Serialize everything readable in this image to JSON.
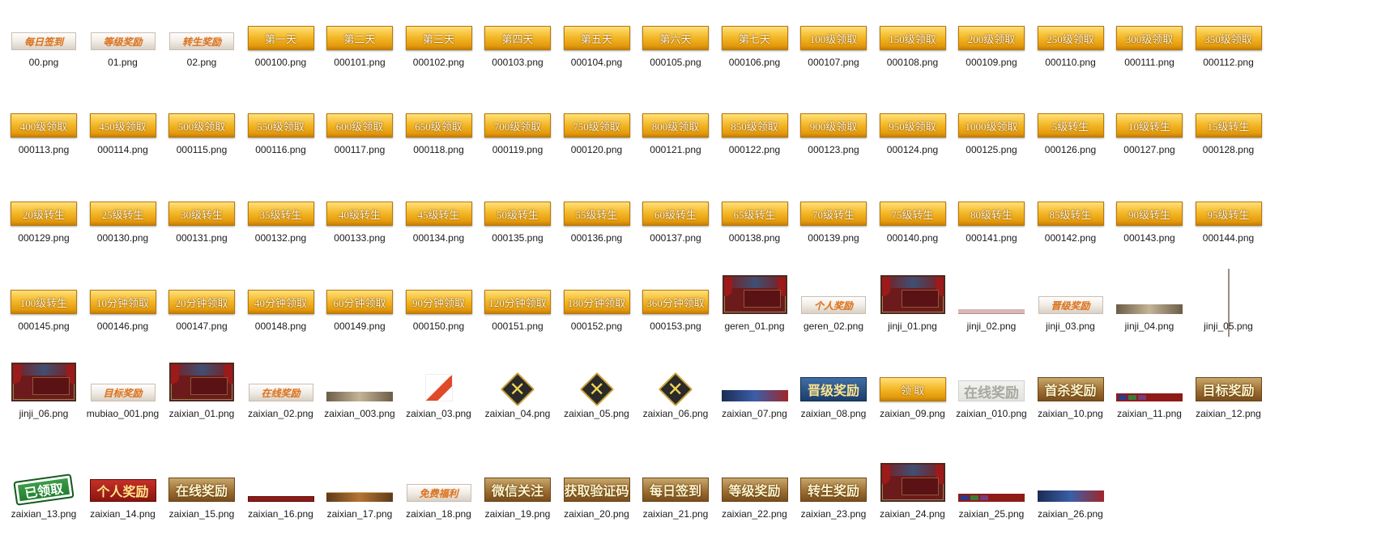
{
  "folder_view": {
    "items": [
      {
        "file": "00.png",
        "style": "scroll",
        "label": "每日签到"
      },
      {
        "file": "01.png",
        "style": "scroll",
        "label": "等级奖励"
      },
      {
        "file": "02.png",
        "style": "scroll",
        "label": "转生奖励"
      },
      {
        "file": "000100.png",
        "style": "gold",
        "label": "第一天"
      },
      {
        "file": "000101.png",
        "style": "gold",
        "label": "第二天"
      },
      {
        "file": "000102.png",
        "style": "gold",
        "label": "第三天"
      },
      {
        "file": "000103.png",
        "style": "gold",
        "label": "第四天"
      },
      {
        "file": "000104.png",
        "style": "gold",
        "label": "第五天"
      },
      {
        "file": "000105.png",
        "style": "gold",
        "label": "第六天"
      },
      {
        "file": "000106.png",
        "style": "gold",
        "label": "第七天"
      },
      {
        "file": "000107.png",
        "style": "gold",
        "label": "100级领取"
      },
      {
        "file": "000108.png",
        "style": "gold",
        "label": "150级领取"
      },
      {
        "file": "000109.png",
        "style": "gold",
        "label": "200级领取"
      },
      {
        "file": "000110.png",
        "style": "gold",
        "label": "250级领取"
      },
      {
        "file": "000111.png",
        "style": "gold",
        "label": "300级领取"
      },
      {
        "file": "000112.png",
        "style": "gold",
        "label": "350级领取"
      },
      {
        "file": "000113.png",
        "style": "gold",
        "label": "400级领取"
      },
      {
        "file": "000114.png",
        "style": "gold",
        "label": "450级领取"
      },
      {
        "file": "000115.png",
        "style": "gold",
        "label": "500级领取"
      },
      {
        "file": "000116.png",
        "style": "gold",
        "label": "550级领取"
      },
      {
        "file": "000117.png",
        "style": "gold",
        "label": "600级领取"
      },
      {
        "file": "000118.png",
        "style": "gold",
        "label": "650级领取"
      },
      {
        "file": "000119.png",
        "style": "gold",
        "label": "700级领取"
      },
      {
        "file": "000120.png",
        "style": "gold",
        "label": "750级领取"
      },
      {
        "file": "000121.png",
        "style": "gold",
        "label": "800级领取"
      },
      {
        "file": "000122.png",
        "style": "gold",
        "label": "850级领取"
      },
      {
        "file": "000123.png",
        "style": "gold",
        "label": "900级领取"
      },
      {
        "file": "000124.png",
        "style": "gold",
        "label": "950级领取"
      },
      {
        "file": "000125.png",
        "style": "gold",
        "label": "1000级领取"
      },
      {
        "file": "000126.png",
        "style": "gold",
        "label": "5级转生"
      },
      {
        "file": "000127.png",
        "style": "gold",
        "label": "10级转生"
      },
      {
        "file": "000128.png",
        "style": "gold",
        "label": "15级转生"
      },
      {
        "file": "000129.png",
        "style": "gold",
        "label": "20级转生"
      },
      {
        "file": "000130.png",
        "style": "gold",
        "label": "25级转生"
      },
      {
        "file": "000131.png",
        "style": "gold",
        "label": "30级转生"
      },
      {
        "file": "000132.png",
        "style": "gold",
        "label": "35级转生"
      },
      {
        "file": "000133.png",
        "style": "gold",
        "label": "40级转生"
      },
      {
        "file": "000134.png",
        "style": "gold",
        "label": "45级转生"
      },
      {
        "file": "000135.png",
        "style": "gold",
        "label": "50级转生"
      },
      {
        "file": "000136.png",
        "style": "gold",
        "label": "55级转生"
      },
      {
        "file": "000137.png",
        "style": "gold",
        "label": "60级转生"
      },
      {
        "file": "000138.png",
        "style": "gold",
        "label": "65级转生"
      },
      {
        "file": "000139.png",
        "style": "gold",
        "label": "70级转生"
      },
      {
        "file": "000140.png",
        "style": "gold",
        "label": "75级转生"
      },
      {
        "file": "000141.png",
        "style": "gold",
        "label": "80级转生"
      },
      {
        "file": "000142.png",
        "style": "gold",
        "label": "85级转生"
      },
      {
        "file": "000143.png",
        "style": "gold",
        "label": "90级转生"
      },
      {
        "file": "000144.png",
        "style": "gold",
        "label": "95级转生"
      },
      {
        "file": "000145.png",
        "style": "gold",
        "label": "100级转生"
      },
      {
        "file": "000146.png",
        "style": "gold",
        "label": "10分钟领取"
      },
      {
        "file": "000147.png",
        "style": "gold",
        "label": "20分钟领取"
      },
      {
        "file": "000148.png",
        "style": "gold",
        "label": "40分钟领取"
      },
      {
        "file": "000149.png",
        "style": "gold",
        "label": "60分钟领取"
      },
      {
        "file": "000150.png",
        "style": "gold",
        "label": "90分钟领取"
      },
      {
        "file": "000151.png",
        "style": "gold",
        "label": "120分钟领取"
      },
      {
        "file": "000152.png",
        "style": "gold",
        "label": "180分钟领取"
      },
      {
        "file": "000153.png",
        "style": "gold",
        "label": "360分钟领取"
      },
      {
        "file": "geren_01.png",
        "style": "panel",
        "label": ""
      },
      {
        "file": "geren_02.png",
        "style": "scroll",
        "label": "个人奖励"
      },
      {
        "file": "jinji_01.png",
        "style": "panel",
        "label": ""
      },
      {
        "file": "jinji_02.png",
        "style": "hline",
        "label": ""
      },
      {
        "file": "jinji_03.png",
        "style": "scroll",
        "label": "晋级奖励"
      },
      {
        "file": "jinji_04.png",
        "style": "bar-text",
        "label": ""
      },
      {
        "file": "jinji_05.png",
        "style": "vline",
        "label": ""
      },
      {
        "file": "jinji_06.png",
        "style": "panel",
        "label": ""
      },
      {
        "file": "mubiao_001.png",
        "style": "scroll",
        "label": "目标奖励"
      },
      {
        "file": "zaixian_01.png",
        "style": "panel",
        "label": ""
      },
      {
        "file": "zaixian_02.png",
        "style": "scroll",
        "label": "在线奖励"
      },
      {
        "file": "zaixian_003.png",
        "style": "bar-text",
        "label": ""
      },
      {
        "file": "zaixian_03.png",
        "style": "corner",
        "label": ""
      },
      {
        "file": "zaixian_04.png",
        "style": "xicon",
        "label": "✕"
      },
      {
        "file": "zaixian_05.png",
        "style": "xicon",
        "label": "✕"
      },
      {
        "file": "zaixian_06.png",
        "style": "xicon",
        "label": "✕"
      },
      {
        "file": "zaixian_07.png",
        "style": "bar-blue",
        "label": ""
      },
      {
        "file": "zaixian_08.png",
        "style": "blue",
        "label": "晋级奖励"
      },
      {
        "file": "zaixian_09.png",
        "style": "gold",
        "label": "领 取"
      },
      {
        "file": "zaixian_010.png",
        "style": "grey",
        "label": "在线奖励"
      },
      {
        "file": "zaixian_10.png",
        "style": "brown",
        "label": "首杀奖励"
      },
      {
        "file": "zaixian_11.png",
        "style": "swatches",
        "label": ""
      },
      {
        "file": "zaixian_12.png",
        "style": "brown",
        "label": "目标奖励"
      },
      {
        "file": "zaixian_13.png",
        "style": "green",
        "label": "已领取"
      },
      {
        "file": "zaixian_14.png",
        "style": "redbtn",
        "label": "个人奖励"
      },
      {
        "file": "zaixian_15.png",
        "style": "brown",
        "label": "在线奖励"
      },
      {
        "file": "zaixian_16.png",
        "style": "bar-red",
        "label": ""
      },
      {
        "file": "zaixian_17.png",
        "style": "bar-dark",
        "label": ""
      },
      {
        "file": "zaixian_18.png",
        "style": "scroll",
        "label": "免费福利"
      },
      {
        "file": "zaixian_19.png",
        "style": "brown",
        "label": "微信关注"
      },
      {
        "file": "zaixian_20.png",
        "style": "brown",
        "label": "获取验证码"
      },
      {
        "file": "zaixian_21.png",
        "style": "brown",
        "label": "每日签到"
      },
      {
        "file": "zaixian_22.png",
        "style": "brown",
        "label": "等级奖励"
      },
      {
        "file": "zaixian_23.png",
        "style": "brown",
        "label": "转生奖励"
      },
      {
        "file": "zaixian_24.png",
        "style": "panel",
        "label": ""
      },
      {
        "file": "zaixian_25.png",
        "style": "swatches",
        "label": ""
      },
      {
        "file": "zaixian_26.png",
        "style": "bar-blue",
        "label": ""
      }
    ]
  }
}
